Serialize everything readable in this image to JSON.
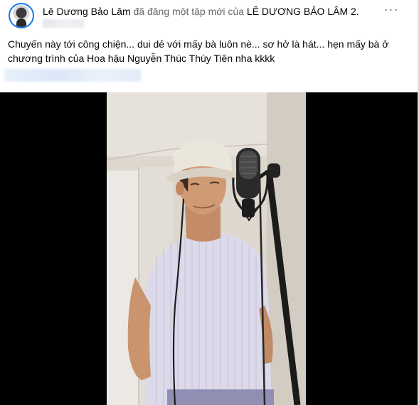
{
  "post": {
    "author": "Lê Dương Bảo Lâm",
    "action": " đã đăng một tập mới của ",
    "page_name": "LÊ DƯƠNG BẢO LÂM 2.",
    "more_label": "···",
    "caption_line1": "Chuyến này tới công chiện... dui dẻ với mấy bà luôn nè... sơ hở là hát... hẹn mấy bà ở",
    "caption_line2": "chương trình của Hoa hậu Nguyễn Thúc Thùy Tiên nha kkkk"
  },
  "colors": {
    "link_blue": "#1877f2",
    "text_primary": "#050505",
    "text_secondary": "#65676b",
    "video_bg": "#000000"
  },
  "icons": [
    "more-options-icon"
  ]
}
